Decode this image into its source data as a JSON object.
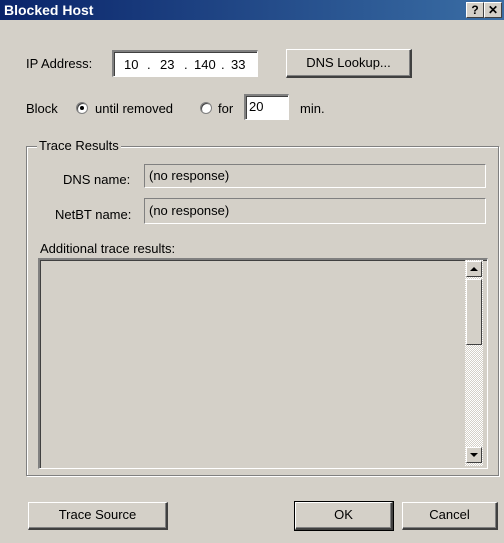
{
  "window": {
    "title": "Blocked Host",
    "help_glyph": "?",
    "close_glyph": "✕"
  },
  "ip": {
    "label": "IP Address:",
    "octets": [
      "10",
      "23",
      "140",
      "33"
    ],
    "dot": "."
  },
  "dns_button": "DNS Lookup...",
  "block": {
    "label": "Block",
    "until_removed": "until removed",
    "for_label": "for",
    "minutes_value": "20",
    "unit": "min.",
    "selected": "until removed"
  },
  "trace": {
    "group_label": "Trace Results",
    "dns_name_label": "DNS name:",
    "dns_name_value": "(no response)",
    "netbt_name_label": "NetBT name:",
    "netbt_name_value": "(no response)",
    "additional_label": "Additional trace results:",
    "additional_text": ""
  },
  "buttons": {
    "trace_source": "Trace Source",
    "ok": "OK",
    "cancel": "Cancel"
  },
  "colors": {
    "title_start": "#0a246a",
    "title_end": "#3a6ea5",
    "face": "#d4d0c8"
  }
}
